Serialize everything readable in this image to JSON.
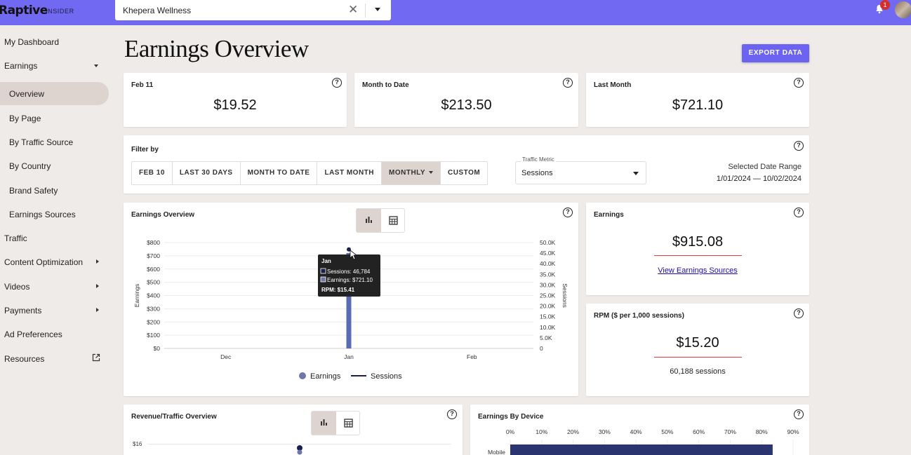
{
  "brand": {
    "logo": "Raptive",
    "sub": "INSIDER"
  },
  "site_selector": {
    "value": "Khepera Wellness"
  },
  "notifications": {
    "count": "1"
  },
  "sidebar": {
    "items": [
      {
        "label": "My Dashboard"
      },
      {
        "label": "Earnings"
      },
      {
        "label": "Overview"
      },
      {
        "label": "By Page"
      },
      {
        "label": "By Traffic Source"
      },
      {
        "label": "By Country"
      },
      {
        "label": "Brand Safety"
      },
      {
        "label": "Earnings Sources"
      },
      {
        "label": "Traffic"
      },
      {
        "label": "Content Optimization"
      },
      {
        "label": "Videos"
      },
      {
        "label": "Payments"
      },
      {
        "label": "Ad Preferences"
      },
      {
        "label": "Resources"
      }
    ]
  },
  "page": {
    "title": "Earnings Overview",
    "export_label": "EXPORT DATA"
  },
  "summary": [
    {
      "label": "Feb 11",
      "value": "$19.52"
    },
    {
      "label": "Month to Date",
      "value": "$213.50"
    },
    {
      "label": "Last Month",
      "value": "$721.10"
    }
  ],
  "filter": {
    "label": "Filter by",
    "buttons": [
      "FEB 10",
      "LAST 30 DAYS",
      "MONTH TO DATE",
      "LAST MONTH",
      "MONTHLY",
      "CUSTOM"
    ],
    "metric_label": "Traffic Metric",
    "metric_value": "Sessions",
    "range_label": "Selected Date Range",
    "range_value": "1/01/2024 — 10/02/2024"
  },
  "earnings_card": {
    "label": "Earnings",
    "value": "$915.08",
    "link": "View Earnings Sources"
  },
  "rpm_card": {
    "label": "RPM ($ per 1,000 sessions)",
    "value": "$15.20",
    "sessions": "60,188 sessions"
  },
  "overview_chart_title": "Earnings Overview",
  "revenue_traffic": {
    "title": "Revenue/Traffic Overview",
    "ytick_top": "$16"
  },
  "device": {
    "title": "Earnings By Device",
    "ticks": [
      "0%",
      "10%",
      "20%",
      "30%",
      "40%",
      "50%",
      "60%",
      "70%",
      "80%",
      "90%"
    ],
    "row_label": "Mobile",
    "row_value": 83.5
  },
  "chart_data": {
    "type": "bar",
    "title": "Earnings Overview",
    "categories": [
      "Dec",
      "Jan",
      "Feb"
    ],
    "series": [
      {
        "name": "Earnings",
        "values": [
          0,
          721.1,
          0
        ]
      },
      {
        "name": "Sessions",
        "values": [
          0,
          46784,
          0
        ]
      }
    ],
    "ylabel": "Earnings",
    "y2label": "Sessions",
    "ylim": [
      0,
      800
    ],
    "y2lim": [
      0,
      50000
    ],
    "yticks": [
      "$0",
      "$100",
      "$200",
      "$300",
      "$400",
      "$500",
      "$600",
      "$700",
      "$800"
    ],
    "y2ticks": [
      "0",
      "5.0K",
      "10.0K",
      "15.0K",
      "20.0K",
      "25.0K",
      "30.0K",
      "35.0K",
      "40.0K",
      "45.0K",
      "50.0K"
    ],
    "legend": [
      "Earnings",
      "Sessions"
    ],
    "tooltip": {
      "title": "Jan",
      "sessions": "Sessions: 46,784",
      "earnings": "Earnings: $721.10",
      "rpm": "RPM: $15.41"
    }
  }
}
